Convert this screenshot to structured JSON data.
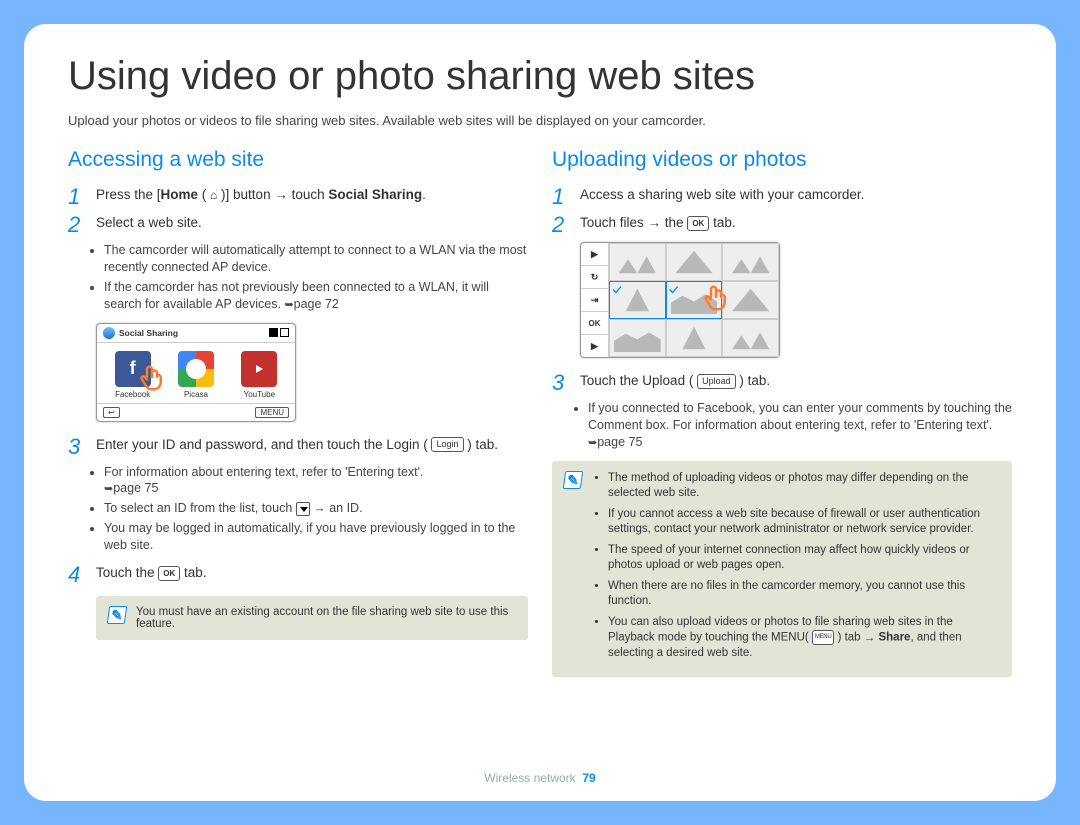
{
  "title": "Using video or photo sharing web sites",
  "intro": "Upload your photos or videos to file sharing web sites. Available web sites will be displayed on your camcorder.",
  "left": {
    "heading": "Accessing a web site",
    "step1_a": "Press the [",
    "step1_b": "Home",
    "step1_c": " ( ",
    "step1_d": " )] button ",
    "step1_e": " touch ",
    "step1_f": "Social Sharing",
    "step1_g": ".",
    "step2": "Select a web site.",
    "bullet2a": "The camcorder will automatically attempt to connect to a WLAN via the most recently connected AP device.",
    "bullet2b": "If the camcorder has not previously been connected to a WLAN, it will search for available AP devices. ",
    "pageref72": "page 72",
    "step3_a": "Enter your ID and password, and then touch the Login ( ",
    "step3_b": "Login",
    "step3_c": " ) tab.",
    "bullet3a": "For information about entering text, refer to 'Entering text'. ",
    "pageref75": "page 75",
    "bullet3b_a": "To select an ID from the list, touch ",
    "bullet3b_b": " an ID.",
    "bullet3c": "You may be logged in automatically, if you have previously logged in to the web site.",
    "step4_a": "Touch the ",
    "ok_label": "OK",
    "step4_b": " tab.",
    "note": "You must have an existing account on the file sharing web site to use this feature.",
    "screen": {
      "topLabel": "Social Sharing",
      "fb": "Facebook",
      "picasa": "Picasa",
      "yt": "YouTube",
      "back": "↩",
      "menu": "MENU"
    }
  },
  "right": {
    "heading": "Uploading videos or photos",
    "step1": "Access a sharing web site with your camcorder.",
    "step2_a": "Touch files ",
    "step2_b": " the ",
    "step2_c": " tab.",
    "step3_a": "Touch the Upload ( ",
    "upload_label": "Upload",
    "step3_b": " ) tab.",
    "bullet3": "If you connected to Facebook, you can enter your comments by touching the Comment box. For information about entering text, refer to 'Entering text'. ",
    "pageref75b": "page 75",
    "notes": {
      "n1": "The method of uploading videos or photos may differ depending on the selected web site.",
      "n2": "If you cannot access a web site because of firewall or user authentication settings, contact your network administrator or network service provider.",
      "n3": "The speed of your internet connection may affect how quickly videos or photos upload or web pages open.",
      "n4": "When there are no files in the camcorder memory, you cannot use this function.",
      "n5_a": "You can also upload videos or photos to file sharing web sites in the Playback mode by touching the MENU( ",
      "n5_b": " ) tab ",
      "share": "Share",
      "n5_c": ", and then selecting a desired web site."
    },
    "side": [
      "▶",
      "↻",
      "⇥",
      "OK",
      "▶"
    ]
  },
  "footer": {
    "section": "Wireless network",
    "page": "79"
  }
}
